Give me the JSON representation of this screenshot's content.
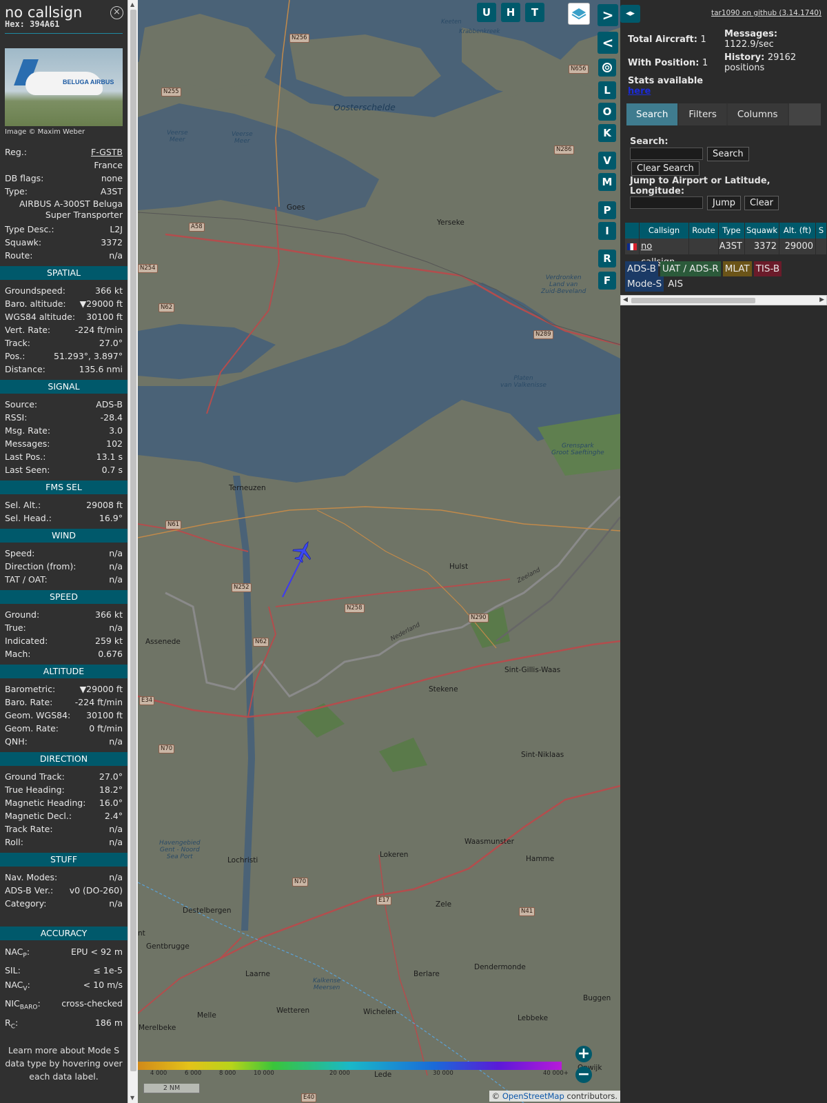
{
  "infoblock": {
    "callsign": "no callsign",
    "hex": "Hex: 394A61",
    "close_icon": "×",
    "image_credit": "Image © Maxim Weber",
    "photo_caption": "BELUGA AIRBUS",
    "general": [
      {
        "k": "Reg.:",
        "v": "F-GSTB",
        "link": true
      },
      {
        "k": "",
        "v": "France"
      },
      {
        "k": "DB flags:",
        "v": "none"
      },
      {
        "k": "Type:",
        "v": "A3ST"
      }
    ],
    "type_full": [
      "AIRBUS A-300ST Beluga",
      "Super Transporter"
    ],
    "general2": [
      {
        "k": "Type Desc.:",
        "v": "L2J"
      },
      {
        "k": "Squawk:",
        "v": "3372"
      },
      {
        "k": "Route:",
        "v": "n/a"
      }
    ],
    "sections": [
      {
        "title": "SPATIAL",
        "rows": [
          {
            "k": "Groundspeed:",
            "v": "366 kt"
          },
          {
            "k": "Baro. altitude:",
            "v": "▼29000 ft"
          },
          {
            "k": "WGS84 altitude:",
            "v": "30100 ft"
          },
          {
            "k": "Vert. Rate:",
            "v": "-224 ft/min"
          },
          {
            "k": "Track:",
            "v": "27.0°"
          },
          {
            "k": "Pos.:",
            "v": "51.293°, 3.897°"
          },
          {
            "k": "Distance:",
            "v": "135.6 nmi"
          }
        ]
      },
      {
        "title": "SIGNAL",
        "rows": [
          {
            "k": "Source:",
            "v": "ADS-B"
          },
          {
            "k": "RSSI:",
            "v": "-28.4"
          },
          {
            "k": "Msg. Rate:",
            "v": "3.0"
          },
          {
            "k": "Messages:",
            "v": "102"
          },
          {
            "k": "Last Pos.:",
            "v": "13.1 s"
          },
          {
            "k": "Last Seen:",
            "v": "0.7 s"
          }
        ]
      },
      {
        "title": "FMS SEL",
        "rows": [
          {
            "k": "Sel. Alt.:",
            "v": "29008 ft"
          },
          {
            "k": "Sel. Head.:",
            "v": "16.9°"
          }
        ]
      },
      {
        "title": "WIND",
        "rows": [
          {
            "k": "Speed:",
            "v": "n/a"
          },
          {
            "k": "Direction (from):",
            "v": "n/a"
          },
          {
            "k": "TAT / OAT:",
            "v": "n/a"
          }
        ]
      },
      {
        "title": "SPEED",
        "rows": [
          {
            "k": "Ground:",
            "v": "366 kt"
          },
          {
            "k": "True:",
            "v": "n/a"
          },
          {
            "k": "Indicated:",
            "v": "259 kt"
          },
          {
            "k": "Mach:",
            "v": "0.676"
          }
        ]
      },
      {
        "title": "ALTITUDE",
        "rows": [
          {
            "k": "Barometric:",
            "v": "▼29000 ft"
          },
          {
            "k": "Baro. Rate:",
            "v": "-224 ft/min"
          },
          {
            "k": "Geom. WGS84:",
            "v": "30100 ft"
          },
          {
            "k": "Geom. Rate:",
            "v": "0 ft/min"
          },
          {
            "k": "QNH:",
            "v": "n/a"
          }
        ]
      },
      {
        "title": "DIRECTION",
        "rows": [
          {
            "k": "Ground Track:",
            "v": "27.0°"
          },
          {
            "k": "True Heading:",
            "v": "18.2°"
          },
          {
            "k": "Magnetic Heading:",
            "v": "16.0°"
          },
          {
            "k": "Magnetic Decl.:",
            "v": "2.4°"
          },
          {
            "k": "Track Rate:",
            "v": "n/a"
          },
          {
            "k": "Roll:",
            "v": "n/a"
          }
        ]
      },
      {
        "title": "STUFF",
        "rows": [
          {
            "k": "Nav. Modes:",
            "v": "n/a"
          },
          {
            "k": "ADS-B Ver.:",
            "v": "v0 (DO-260)"
          },
          {
            "k": "Category:",
            "v": "n/a"
          }
        ]
      }
    ],
    "accuracy_title": "ACCURACY",
    "accuracy": {
      "nacp_k": "NAC",
      "nacp_sub": "P",
      "nacp_v": "EPU < 92 m",
      "sil_k": "SIL:",
      "sil_v": "≤ 1e-5",
      "nacv_k": "NAC",
      "nacv_sub": "V",
      "nacv_v": "< 10 m/s",
      "nic_k": "NIC",
      "nic_sub": "BARO",
      "nic_v": "cross-checked",
      "rc_k": "R",
      "rc_sub": "C",
      "rc_v": "186 m"
    },
    "footer": "Learn more about Mode S data type by hovering over each data label."
  },
  "map": {
    "buttons_top": [
      "U",
      "H",
      "T"
    ],
    "buttons_side": [
      "L",
      "O",
      "K",
      "V",
      "M",
      "P",
      "I",
      "R",
      "F"
    ],
    "nav_next": ">",
    "nav_prev": "<",
    "settings_icon": "gear-icon",
    "layers_icon": "layers-icon",
    "zoom_in": "+",
    "zoom_out": "−",
    "scale": "2 NM",
    "attribution_prefix": "© ",
    "attribution_link": "OpenStreetMap",
    "attribution_suffix": " contributors.",
    "altitude_ticks": [
      "4 000",
      "6 000",
      "8 000",
      "10 000",
      "20 000",
      "30 000",
      "40 000+"
    ],
    "places": [
      {
        "n": "Oosterschelde",
        "c": "water"
      },
      {
        "n": "Goes"
      },
      {
        "n": "Yerseke"
      },
      {
        "n": "Terneuzen"
      },
      {
        "n": "Hulst"
      },
      {
        "n": "Assenede"
      },
      {
        "n": "Stekene"
      },
      {
        "n": "Sint-Gillis-Waas"
      },
      {
        "n": "Sint-Niklaas"
      },
      {
        "n": "Waasmunster"
      },
      {
        "n": "Lokeren"
      },
      {
        "n": "Hamme"
      },
      {
        "n": "Lochristi"
      },
      {
        "n": "Zele"
      },
      {
        "n": "Destelbergen"
      },
      {
        "n": "Gentbrugge"
      },
      {
        "n": "Laarne"
      },
      {
        "n": "Berlare"
      },
      {
        "n": "Dendermonde"
      },
      {
        "n": "Wetteren"
      },
      {
        "n": "Wichelen"
      },
      {
        "n": "Lebbeke"
      },
      {
        "n": "Melle"
      },
      {
        "n": "Merelbeke"
      },
      {
        "n": "Lede"
      },
      {
        "n": "Opwijk"
      },
      {
        "n": "Buggen"
      },
      {
        "n": "nt"
      },
      {
        "n": "Keeten"
      },
      {
        "n": "Krabbenkreek"
      }
    ],
    "small_water": [
      "Veerse\nMeer",
      "Veerse\nMeer",
      "Verdronken\nLand van\nZuid-Beveland",
      "Platen\nvan Valkenisse",
      "Grenspark\nGroot Saeftinghe",
      "Kalkense\nMeersen",
      "Havengebied\nGent - Noord\nSea Port",
      "Nederland",
      "Zeeland"
    ],
    "roads": [
      "N256",
      "N656",
      "N255",
      "N286",
      "A58",
      "N254",
      "N62",
      "N289",
      "N61",
      "N252",
      "N258",
      "N290",
      "N62",
      "E34",
      "N70",
      "E17",
      "N41",
      "E40",
      "N70"
    ]
  },
  "right": {
    "toggle": "◂▸",
    "github": "tar1090 on github (3.14.1740)",
    "total_label": "Total Aircraft:",
    "total_value": "1",
    "withpos_label": "With Position:",
    "withpos_value": "1",
    "messages_label": "Messages:",
    "messages_value": "1122.9/sec",
    "history_label": "History:",
    "history_value": "29162 positions",
    "stats_label": "Stats available",
    "stats_link": "here",
    "tabs": [
      "Search",
      "Filters",
      "Columns"
    ],
    "search_label": "Search:",
    "search_button": "Search",
    "clear_search": "Clear Search",
    "jump_label": "Jump to Airport or Latitude, Longitude:",
    "jump_button": "Jump",
    "clear_button": "Clear",
    "table": {
      "headers": [
        "",
        "Callsign",
        "Route",
        "Type",
        "Squawk",
        "Alt. (ft)",
        "S"
      ],
      "row": [
        "",
        "no callsign",
        "",
        "A3ST",
        "3372",
        "29000",
        ""
      ]
    },
    "legend": [
      {
        "label": "ADS-B",
        "color": "#1b3a66"
      },
      {
        "label": "UAT / ADS-R",
        "color": "#2b5a3a"
      },
      {
        "label": "MLAT",
        "color": "#6b5418"
      },
      {
        "label": "TIS-B",
        "color": "#6b1b2a"
      },
      {
        "label": "Mode-S",
        "color": "#1b3a66"
      },
      {
        "label": "AIS",
        "color": "#2b2b2b"
      }
    ]
  }
}
